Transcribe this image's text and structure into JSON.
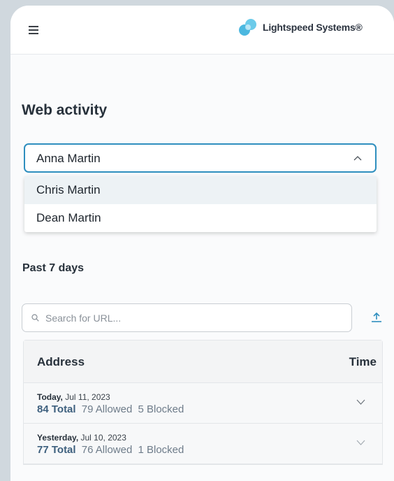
{
  "header": {
    "menu_icon": "hamburger-menu-icon",
    "brand_logo": "lightspeed-logo",
    "brand_name": "Lightspeed Systems®",
    "brand_color": "#4cb8e0"
  },
  "page": {
    "title": "Web activity"
  },
  "student_select": {
    "selected": "Anna Martin",
    "icon": "chevron-up-icon",
    "accent_color": "#2f8fbf",
    "options": [
      "Chris Martin",
      "Dean Martin"
    ]
  },
  "range": {
    "label": "Past 7 days"
  },
  "search": {
    "placeholder": "Search for URL...",
    "value": "",
    "icon": "search-icon",
    "export_icon": "upload-export-icon"
  },
  "table": {
    "headers": {
      "address": "Address",
      "time": "Time"
    },
    "rows": [
      {
        "day": "Today,",
        "date": "Jul 11, 2023",
        "total": "84 Total",
        "allowed": "79 Allowed",
        "blocked": "5 Blocked"
      },
      {
        "day": "Yesterday,",
        "date": "Jul 10, 2023",
        "total": "77 Total",
        "allowed": "76 Allowed",
        "blocked": "1 Blocked"
      }
    ]
  }
}
